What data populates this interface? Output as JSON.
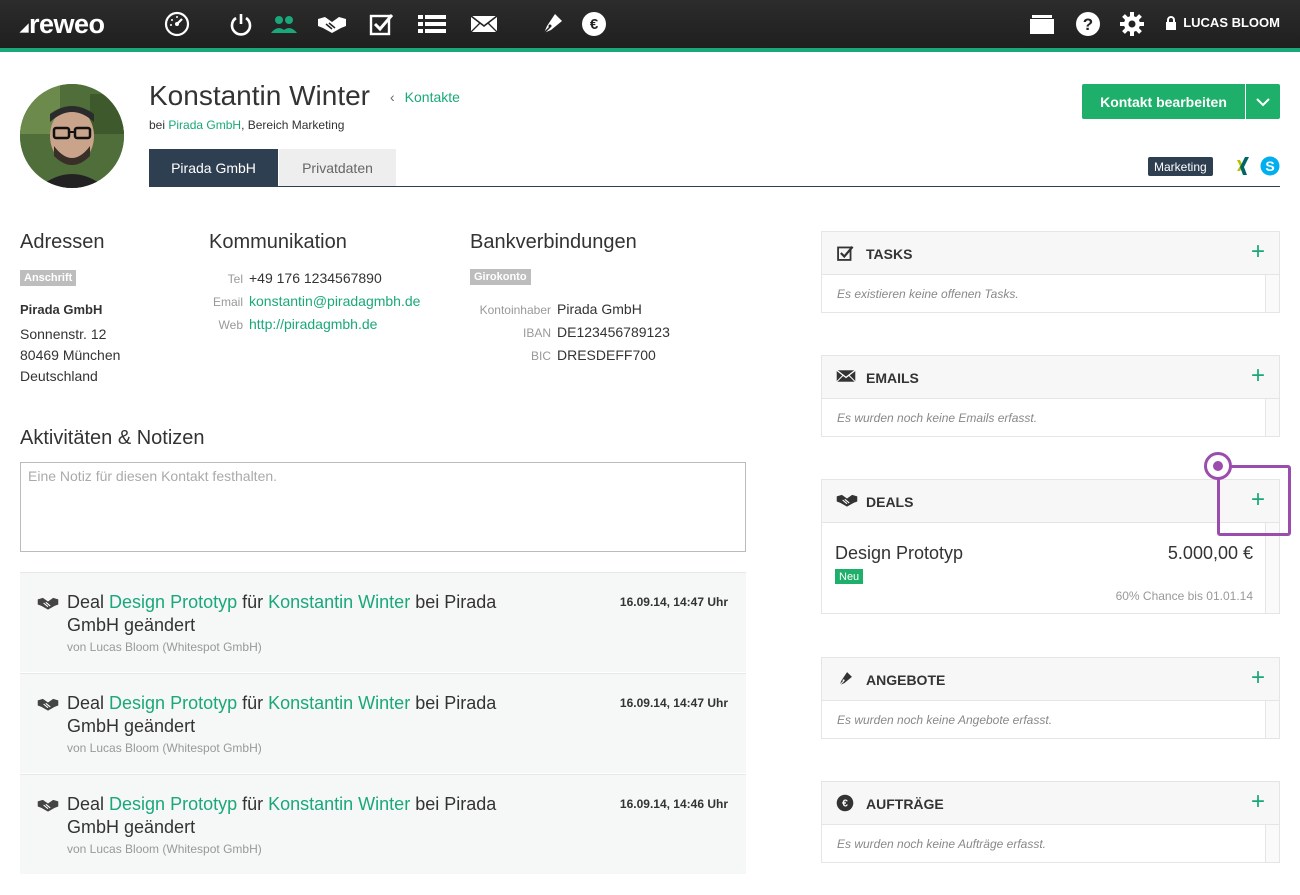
{
  "topbar": {
    "logo": "reweo",
    "nav": [
      "dashboard-icon",
      "power-icon",
      "contacts-icon",
      "deals-handshake-icon",
      "tasks-check-icon",
      "list-icon",
      "mail-icon",
      "pen-icon",
      "euro-icon"
    ],
    "right_icons": [
      "folder-icon",
      "help-icon",
      "gear-icon"
    ],
    "user_name": "LUCAS BLOOM",
    "accent_color": "#1aa87a"
  },
  "header": {
    "name": "Konstantin Winter",
    "breadcrumb_link": "Kontakte",
    "sub_prefix": "bei ",
    "company_link": "Pirada GmbH",
    "sub_suffix": ", Bereich Marketing",
    "edit_button": "Kontakt bearbeiten",
    "tag": "Marketing",
    "tabs": [
      {
        "label": "Pirada GmbH",
        "active": true
      },
      {
        "label": "Privatdaten",
        "active": false
      }
    ]
  },
  "addresses": {
    "title": "Adressen",
    "badge": "Anschrift",
    "company": "Pirada GmbH",
    "street": "Sonnenstr. 12",
    "city": "80469 München",
    "country": "Deutschland"
  },
  "communication": {
    "title": "Kommunikation",
    "rows": [
      {
        "label": "Tel",
        "value": "+49 176 1234567890"
      },
      {
        "label": "Email",
        "value": "konstantin@piradagmbh.de"
      },
      {
        "label": "Web",
        "value": "http://piradagmbh.de"
      }
    ]
  },
  "bank": {
    "title": "Bankverbindungen",
    "badge": "Girokonto",
    "rows": [
      {
        "label": "Kontoinhaber",
        "value": "Pirada GmbH"
      },
      {
        "label": "IBAN",
        "value": "DE123456789123"
      },
      {
        "label": "BIC",
        "value": "DRESDEFF700"
      }
    ]
  },
  "activities": {
    "title": "Aktivitäten & Notizen",
    "note_placeholder": "Eine Notiz für diesen Kontakt festhalten.",
    "items": [
      {
        "w1": "Deal ",
        "deal": "Design Prototyp",
        "w2": " für ",
        "person": "Konstantin Winter",
        "w3": " bei Pirada GmbH geändert",
        "by": "von Lucas Bloom (Whitespot GmbH)",
        "time": "16.09.14, 14:47 Uhr"
      },
      {
        "w1": "Deal ",
        "deal": "Design Prototyp",
        "w2": " für ",
        "person": "Konstantin Winter",
        "w3": " bei Pirada GmbH geändert",
        "by": "von Lucas Bloom (Whitespot GmbH)",
        "time": "16.09.14, 14:47 Uhr"
      },
      {
        "w1": "Deal ",
        "deal": "Design Prototyp",
        "w2": " für ",
        "person": "Konstantin Winter",
        "w3": " bei Pirada GmbH geändert",
        "by": "von Lucas Bloom (Whitespot GmbH)",
        "time": "16.09.14, 14:46 Uhr"
      }
    ]
  },
  "panels": {
    "add_symbol": "+",
    "tasks": {
      "title": "TASKS",
      "empty": "Es existieren keine offenen Tasks."
    },
    "emails": {
      "title": "EMAILS",
      "empty": "Es wurden noch keine Emails erfasst."
    },
    "deals": {
      "title": "DEALS",
      "deal_name": "Design Prototyp",
      "amount": "5.000,00 €",
      "badge": "Neu",
      "chance": "60% Chance bis 01.01.14"
    },
    "angebote": {
      "title": "ANGEBOTE",
      "empty": "Es wurden noch keine Angebote erfasst."
    },
    "auftraege": {
      "title": "AUFTRÄGE",
      "empty": "Es wurden noch keine Aufträge erfasst."
    }
  }
}
